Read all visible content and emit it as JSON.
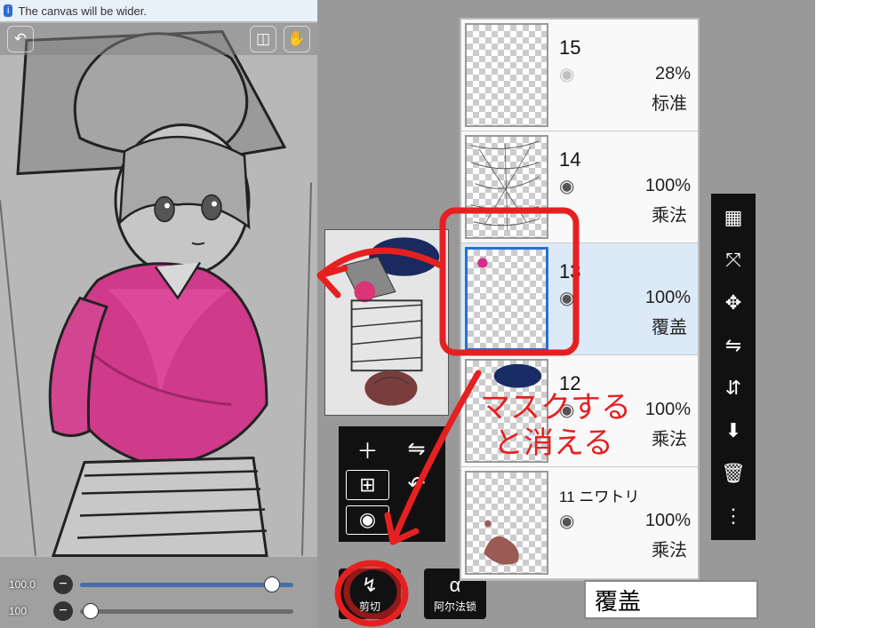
{
  "tutorial": {
    "text": "The canvas will be wider.",
    "badge": "i"
  },
  "top_toolbar": {
    "undo_icon": "↶",
    "select_icon": "◫",
    "hand_icon": "✋"
  },
  "sliders": {
    "brush_size": {
      "value": "100.0",
      "thumb_pct": 90
    },
    "opacity": {
      "value": "100",
      "thumb_pct": 5
    }
  },
  "layer_tools": {
    "add": "＋",
    "flip_h": "⇋",
    "duplicate": "⊞",
    "rotate_ccw": "↶",
    "camera": "◉"
  },
  "bottom_buttons": {
    "clip": {
      "icon": "↯",
      "label": "剪切"
    },
    "alpha_lock": {
      "icon": "α",
      "label": "阿尔法锁"
    }
  },
  "layers": [
    {
      "num": "15",
      "opacity": "28%",
      "blend": "标准",
      "visible": false,
      "selected": false,
      "thumb": "empty"
    },
    {
      "num": "14",
      "opacity": "100%",
      "blend": "乘法",
      "visible": true,
      "selected": false,
      "thumb": "sketch"
    },
    {
      "num": "13",
      "opacity": "100%",
      "blend": "覆盖",
      "visible": true,
      "selected": true,
      "thumb": "dot"
    },
    {
      "num": "12",
      "opacity": "100%",
      "blend": "乘法",
      "visible": true,
      "selected": false,
      "thumb": "spill"
    },
    {
      "num": "11 ニワトリ",
      "opacity": "100%",
      "blend": "乘法",
      "visible": true,
      "selected": false,
      "thumb": "brown"
    }
  ],
  "blend_display": "覆盖",
  "toolstrip": {
    "checker": "▦",
    "transform": "⤧",
    "move": "✥",
    "flip_h": "⇋",
    "flip_v": "⇵",
    "merge_down": "⬇",
    "delete": "🗑",
    "more": "⋮"
  },
  "annotation": {
    "text1": "マスクする",
    "text2": "と消える"
  }
}
